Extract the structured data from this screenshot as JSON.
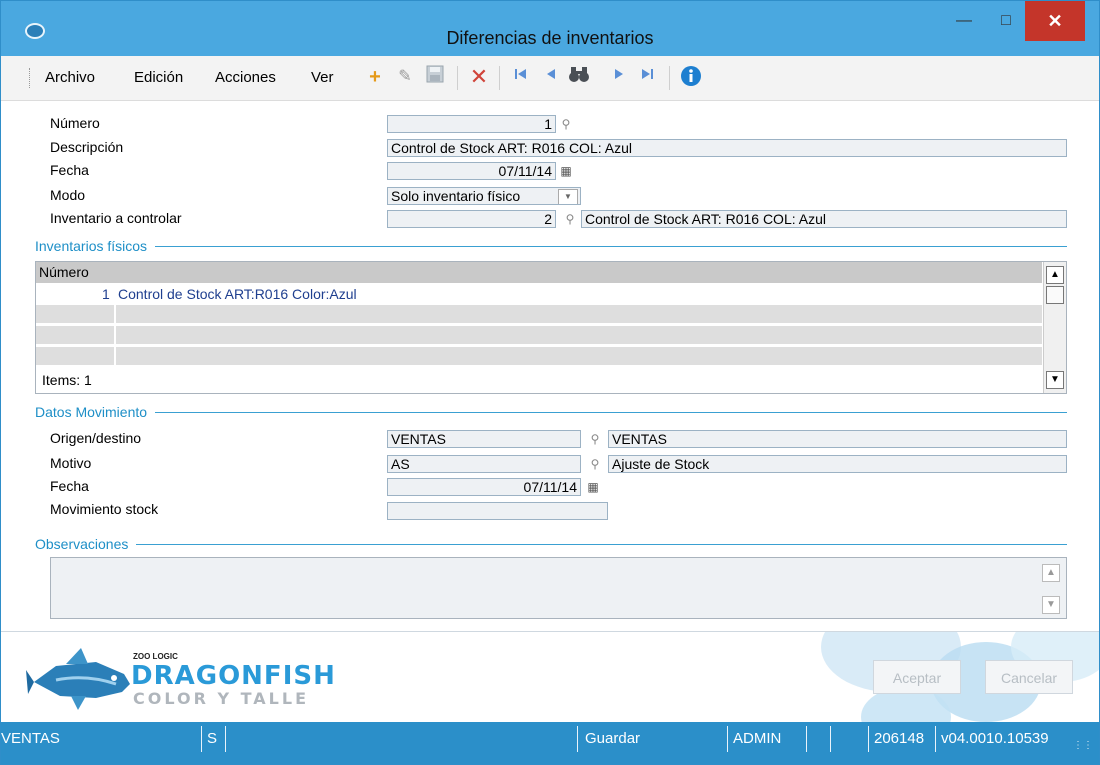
{
  "window": {
    "title": "Diferencias de inventarios"
  },
  "menu": [
    "Archivo",
    "Edición",
    "Acciones",
    "Ver"
  ],
  "toolbar_icons": [
    "add-icon",
    "edit-icon",
    "save-icon",
    "delete-icon",
    "first-record-icon",
    "previous-record-icon",
    "search-binoculars-icon",
    "next-record-icon",
    "last-record-icon",
    "info-icon"
  ],
  "form": {
    "numero": {
      "label": "Número",
      "value": "1"
    },
    "descripcion": {
      "label": "Descripción",
      "value": "Control de Stock ART: R016 COL: Azul"
    },
    "fecha": {
      "label": "Fecha",
      "value": "07/11/14"
    },
    "modo": {
      "label": "Modo",
      "value": "Solo inventario físico"
    },
    "inventario": {
      "label": "Inventario a controlar",
      "value": "2",
      "description": "Control de Stock ART: R016 COL: Azul"
    }
  },
  "inventarios_fisicos": {
    "section_title": "Inventarios físicos",
    "column_header": "Número",
    "rows": [
      {
        "numero": "1",
        "descripcion": "Control de Stock ART:R016 Color:Azul"
      }
    ],
    "items_label": "Items: 1"
  },
  "datos_movimiento": {
    "section_title": "Datos Movimiento",
    "origen": {
      "label": "Origen/destino",
      "code": "VENTAS",
      "description": "VENTAS"
    },
    "motivo": {
      "label": "Motivo",
      "code": "AS",
      "description": "Ajuste de Stock"
    },
    "fecha": {
      "label": "Fecha",
      "value": "07/11/14"
    },
    "movimiento": {
      "label": "Movimiento stock",
      "value": ""
    }
  },
  "observaciones": {
    "section_title": "Observaciones",
    "value": ""
  },
  "branding": {
    "small": "ZOO LOGIC",
    "big": "DRAGONFISH",
    "sub": "COLOR Y TALLE"
  },
  "buttons": {
    "accept": "Aceptar",
    "cancel": "Cancelar"
  },
  "statusbar": [
    "VENTAS",
    "S",
    "",
    "Guardar",
    "ADMIN",
    "",
    "206148",
    "v04.0010.10539"
  ],
  "colors": {
    "titlebar": "#4aa8e0",
    "statusbar": "#2b8fc9",
    "section": "#1e8fc7",
    "close": "#c4352a"
  }
}
